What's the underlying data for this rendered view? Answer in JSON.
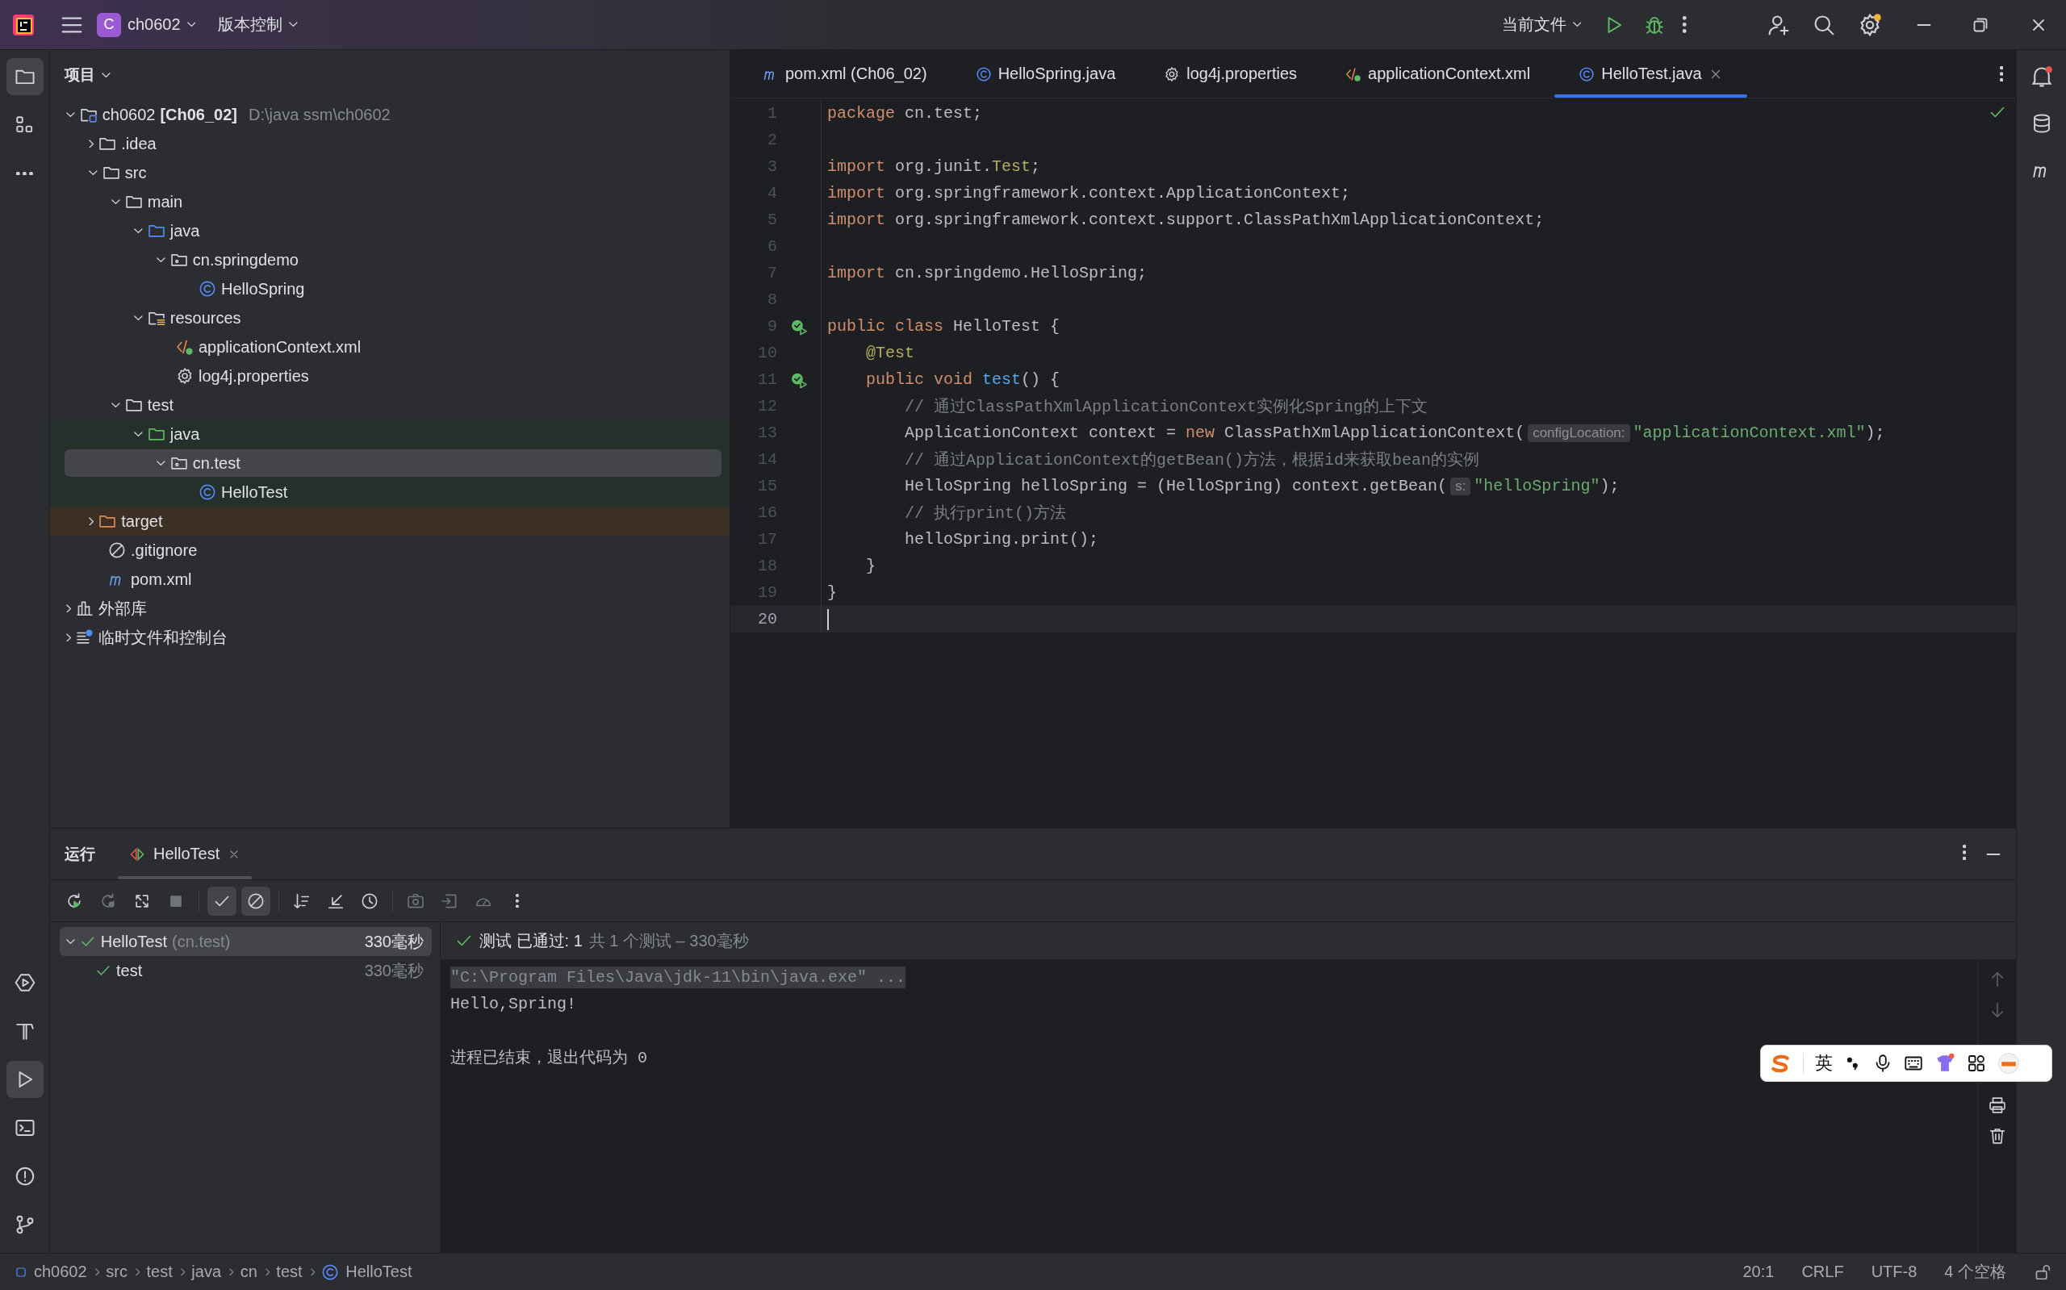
{
  "title_bar": {
    "project_badge": "C",
    "project": "ch0602",
    "vcs": "版本控制",
    "run_config": "当前文件"
  },
  "project": {
    "title": "项目",
    "tree": [
      {
        "label": "ch0602",
        "module": "[Ch06_02]",
        "path": "D:\\java ssm\\ch0602",
        "kind": "module",
        "expanded": true,
        "selected": false,
        "children": [
          {
            "label": ".idea",
            "kind": "folder",
            "expanded": false,
            "selected": false
          },
          {
            "label": "src",
            "kind": "folder",
            "expanded": true,
            "selected": false,
            "children": [
              {
                "label": "main",
                "kind": "folder",
                "expanded": true,
                "selected": false,
                "children": [
                  {
                    "label": "java",
                    "kind": "source",
                    "expanded": true,
                    "selected": false,
                    "children": [
                      {
                        "label": "cn.springdemo",
                        "kind": "package",
                        "expanded": true,
                        "selected": false,
                        "children": [
                          {
                            "label": "HelloSpring",
                            "kind": "class",
                            "selected": false
                          }
                        ]
                      }
                    ]
                  },
                  {
                    "label": "resources",
                    "kind": "resources",
                    "expanded": true,
                    "selected": false,
                    "children": [
                      {
                        "label": "applicationContext.xml",
                        "kind": "xml",
                        "selected": false
                      },
                      {
                        "label": "log4j.properties",
                        "kind": "properties",
                        "selected": false
                      }
                    ]
                  }
                ]
              },
              {
                "label": "test",
                "kind": "folder",
                "expanded": true,
                "selected": false,
                "children": [
                  {
                    "label": "java",
                    "kind": "testsource",
                    "test_scope": true,
                    "expanded": true,
                    "selected": false,
                    "children": [
                      {
                        "label": "cn.test",
                        "kind": "package",
                        "test_scope": true,
                        "expanded": true,
                        "selected": true,
                        "children": [
                          {
                            "label": "HelloTest",
                            "kind": "class",
                            "test_scope": true,
                            "selected": false
                          }
                        ]
                      }
                    ]
                  }
                ]
              }
            ]
          },
          {
            "label": "target",
            "kind": "excluded",
            "excluded": true,
            "expanded": false,
            "selected": false
          },
          {
            "label": ".gitignore",
            "kind": "ignore",
            "selected": false
          },
          {
            "label": "pom.xml",
            "kind": "maven",
            "selected": false
          }
        ]
      },
      {
        "label": "外部库",
        "kind": "library",
        "expanded": false,
        "selected": false
      },
      {
        "label": "临时文件和控制台",
        "kind": "scratch",
        "expanded": false,
        "selected": false
      }
    ]
  },
  "editor": {
    "tabs": [
      {
        "label": "pom.xml (Ch06_02)",
        "kind": "maven",
        "selected": false
      },
      {
        "label": "HelloSpring.java",
        "kind": "class",
        "selected": false
      },
      {
        "label": "log4j.properties",
        "kind": "properties",
        "selected": false
      },
      {
        "label": "applicationContext.xml",
        "kind": "xml",
        "selected": false
      },
      {
        "label": "HelloTest.java",
        "kind": "class",
        "selected": true
      }
    ],
    "lines": [
      {
        "number": "1",
        "tokens": [
          {
            "text": "package",
            "kind": "keyword"
          },
          {
            "text": " cn.test;",
            "kind": "plain"
          }
        ]
      },
      {
        "number": "2"
      },
      {
        "number": "3",
        "tokens": [
          {
            "text": "import",
            "kind": "keyword"
          },
          {
            "text": " org.junit.",
            "kind": "plain"
          },
          {
            "text": "Test",
            "kind": "annotation"
          },
          {
            "text": ";",
            "kind": "plain"
          }
        ]
      },
      {
        "number": "4",
        "tokens": [
          {
            "text": "import",
            "kind": "keyword"
          },
          {
            "text": " org.springframework.context.ApplicationContext;",
            "kind": "plain"
          }
        ]
      },
      {
        "number": "5",
        "tokens": [
          {
            "text": "import",
            "kind": "keyword"
          },
          {
            "text": " org.springframework.context.support.ClassPathXmlApplicationContext;",
            "kind": "plain"
          }
        ]
      },
      {
        "number": "6"
      },
      {
        "number": "7",
        "tokens": [
          {
            "text": "import",
            "kind": "keyword"
          },
          {
            "text": " cn.springdemo.HelloSpring;",
            "kind": "plain"
          }
        ]
      },
      {
        "number": "8"
      },
      {
        "number": "9",
        "run_marker": true,
        "tokens": [
          {
            "text": "public class",
            "kind": "keyword"
          },
          {
            "text": " HelloTest {",
            "kind": "plain"
          }
        ]
      },
      {
        "number": "10",
        "tokens": [
          {
            "text": "    @Test",
            "kind": "annotation"
          }
        ]
      },
      {
        "number": "11",
        "run_marker": true,
        "tokens": [
          {
            "text": "    public void",
            "kind": "keyword"
          },
          {
            "text": " test",
            "kind": "method"
          },
          {
            "text": "() {",
            "kind": "plain"
          }
        ]
      },
      {
        "number": "12",
        "tokens": [
          {
            "text": "        // 通过ClassPathXmlApplicationContext实例化Spring的上下文",
            "kind": "comment"
          }
        ]
      },
      {
        "number": "13",
        "tokens": [
          {
            "text": "        ApplicationContext context = ",
            "kind": "plain"
          },
          {
            "text": "new",
            "kind": "keyword"
          },
          {
            "text": " ClassPathXmlApplicationContext(",
            "kind": "plain"
          },
          {
            "text": "configLocation:",
            "kind": "hint"
          },
          {
            "text": "\"applicationContext.xml\"",
            "kind": "string"
          },
          {
            "text": ");",
            "kind": "plain"
          }
        ]
      },
      {
        "number": "14",
        "tokens": [
          {
            "text": "        // 通过ApplicationContext的getBean()方法，根据id来获取bean的实例",
            "kind": "comment"
          }
        ]
      },
      {
        "number": "15",
        "tokens": [
          {
            "text": "        HelloSpring helloSpring = (HelloSpring) context.getBean(",
            "kind": "plain"
          },
          {
            "text": "s:",
            "kind": "hint"
          },
          {
            "text": "\"helloSpring\"",
            "kind": "string"
          },
          {
            "text": ");",
            "kind": "plain"
          }
        ]
      },
      {
        "number": "16",
        "tokens": [
          {
            "text": "        // 执行print()方法",
            "kind": "comment"
          }
        ]
      },
      {
        "number": "17",
        "tokens": [
          {
            "text": "        helloSpring.print();",
            "kind": "plain"
          }
        ]
      },
      {
        "number": "18",
        "tokens": [
          {
            "text": "    }",
            "kind": "plain"
          }
        ]
      },
      {
        "number": "19",
        "tokens": [
          {
            "text": "}",
            "kind": "plain"
          }
        ]
      },
      {
        "number": "20",
        "current": true
      }
    ]
  },
  "run_panel": {
    "title": "运行",
    "tabs": [
      {
        "label": "HelloTest",
        "selected": true
      }
    ],
    "filters": {
      "show_passed": true,
      "show_ignored": true
    },
    "tests": [
      {
        "name": "HelloTest",
        "package": "(cn.test)",
        "duration": "330毫秒",
        "passed": true,
        "expanded": true,
        "selected": true,
        "children": [
          {
            "name": "test",
            "duration": "330毫秒",
            "passed": true,
            "selected": false
          }
        ]
      }
    ],
    "summary": "测试 已通过: 1",
    "summary_detail": "共 1 个测试 – 330毫秒",
    "console": [
      {
        "text": "\"C:\\Program Files\\Java\\jdk-11\\bin\\java.exe\" ...",
        "kind": "command"
      },
      {
        "text": "Hello,Spring!",
        "kind": "output"
      },
      {
        "text": "进程已结束，退出代码为 0",
        "kind": "exit"
      }
    ]
  },
  "status_bar": {
    "breadcrumbs": [
      {
        "label": "ch0602",
        "kind": "module"
      },
      {
        "label": "src",
        "kind": "folder"
      },
      {
        "label": "test",
        "kind": "folder"
      },
      {
        "label": "java",
        "kind": "folder"
      },
      {
        "label": "cn",
        "kind": "folder"
      },
      {
        "label": "test",
        "kind": "folder"
      },
      {
        "label": "HelloTest",
        "kind": "class"
      }
    ],
    "position": "20:1",
    "line_ending": "CRLF",
    "encoding": "UTF-8",
    "indent": "4 个空格"
  },
  "ime_bar": {
    "mode": "英"
  }
}
